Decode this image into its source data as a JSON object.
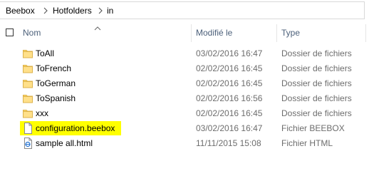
{
  "breadcrumb": {
    "items": [
      "Beebox",
      "Hotfolders",
      "in"
    ]
  },
  "columns": {
    "name": "Nom",
    "modified": "Modifié le",
    "type": "Type"
  },
  "rows": [
    {
      "name": "ToAll",
      "modified": "03/02/2016 16:47",
      "type": "Dossier de fichiers",
      "icon": "folder-icon"
    },
    {
      "name": "ToFrench",
      "modified": "02/02/2016 16:45",
      "type": "Dossier de fichiers",
      "icon": "folder-icon"
    },
    {
      "name": "ToGerman",
      "modified": "02/02/2016 16:45",
      "type": "Dossier de fichiers",
      "icon": "folder-icon"
    },
    {
      "name": "ToSpanish",
      "modified": "02/02/2016 16:56",
      "type": "Dossier de fichiers",
      "icon": "folder-icon"
    },
    {
      "name": "xxx",
      "modified": "02/02/2016 16:45",
      "type": "Dossier de fichiers",
      "icon": "folder-icon"
    },
    {
      "name": "configuration.beebox",
      "modified": "03/02/2016 16:47",
      "type": "Fichier BEEBOX",
      "icon": "blank-file-icon",
      "highlight_color": "#ffff00"
    },
    {
      "name": "sample all.html",
      "modified": "11/11/2015 15:08",
      "type": "Fichier HTML",
      "icon": "html-file-icon"
    }
  ]
}
